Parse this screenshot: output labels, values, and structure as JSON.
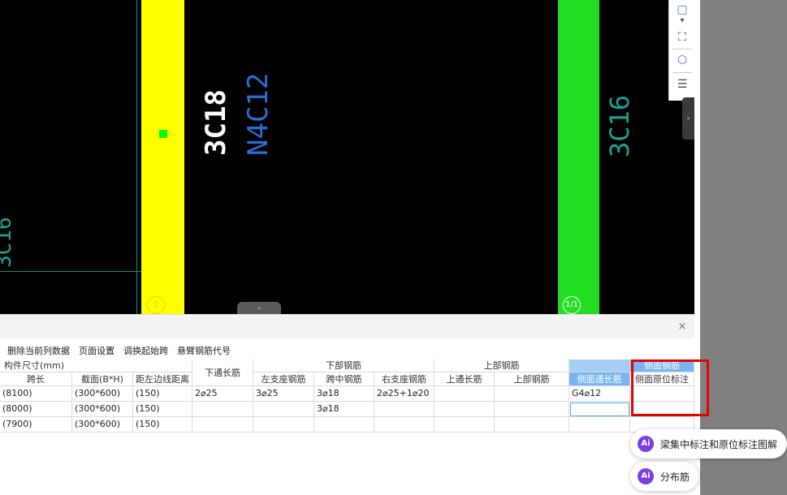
{
  "canvas": {
    "labels": {
      "left_edge": "3C16",
      "mid_white": "3C18",
      "mid_blue": "N4C12",
      "right_cyan": "3C16",
      "axis_left": "1",
      "axis_right": "1/1"
    },
    "colors": {
      "yellow_column": "#ffff00",
      "green_column": "#22dd22",
      "blue_text": "#2a6fd6",
      "cyan_text": "#1aa39a"
    }
  },
  "tools": {
    "items": [
      {
        "icon": "3d-cube-icon",
        "glyph": "▢"
      },
      {
        "icon": "chevron-down-icon",
        "glyph": "▾"
      },
      {
        "icon": "fit-view-icon",
        "glyph": "⛶"
      },
      {
        "icon": "view-cube-icon",
        "glyph": "⬡"
      },
      {
        "icon": "layer-list-icon",
        "glyph": "☰"
      }
    ],
    "side_handle": "›"
  },
  "panel": {
    "close": "×",
    "tab_handle": "⌄",
    "toolbar": [
      "删除当前列数据",
      "页面设置",
      "调换起始跨",
      "悬臂钢筋代号"
    ]
  },
  "table": {
    "group_headers": {
      "size": "构件尺寸(mm)",
      "bottom_bar": "下部钢筋",
      "top_bar": "上部钢筋",
      "side_bar": "侧面钢筋"
    },
    "headers": [
      "跨长",
      "截面(B*H)",
      "距左边线距离",
      "下通长筋",
      "左支座钢筋",
      "跨中钢筋",
      "右支座钢筋",
      "上通长筋",
      "上部钢筋",
      "侧面通长筋",
      "侧面原位标注"
    ],
    "rows": [
      [
        "(8100)",
        "(300*600)",
        "(150)",
        "2⌀25",
        "3⌀25",
        "3⌀18",
        "2⌀25+1⌀20",
        "",
        "",
        "G4⌀12",
        ""
      ],
      [
        "(8000)",
        "(300*600)",
        "(150)",
        "",
        "",
        "3⌀18",
        "",
        "",
        "",
        "",
        ""
      ],
      [
        "(7900)",
        "(300*600)",
        "(150)",
        "",
        "",
        "",
        "",
        "",
        "",
        "",
        ""
      ]
    ]
  },
  "ai_popups": [
    {
      "badge": "Ai",
      "label": "梁集中标注和原位标注图解"
    },
    {
      "badge": "Ai",
      "label": "分布筋"
    }
  ]
}
